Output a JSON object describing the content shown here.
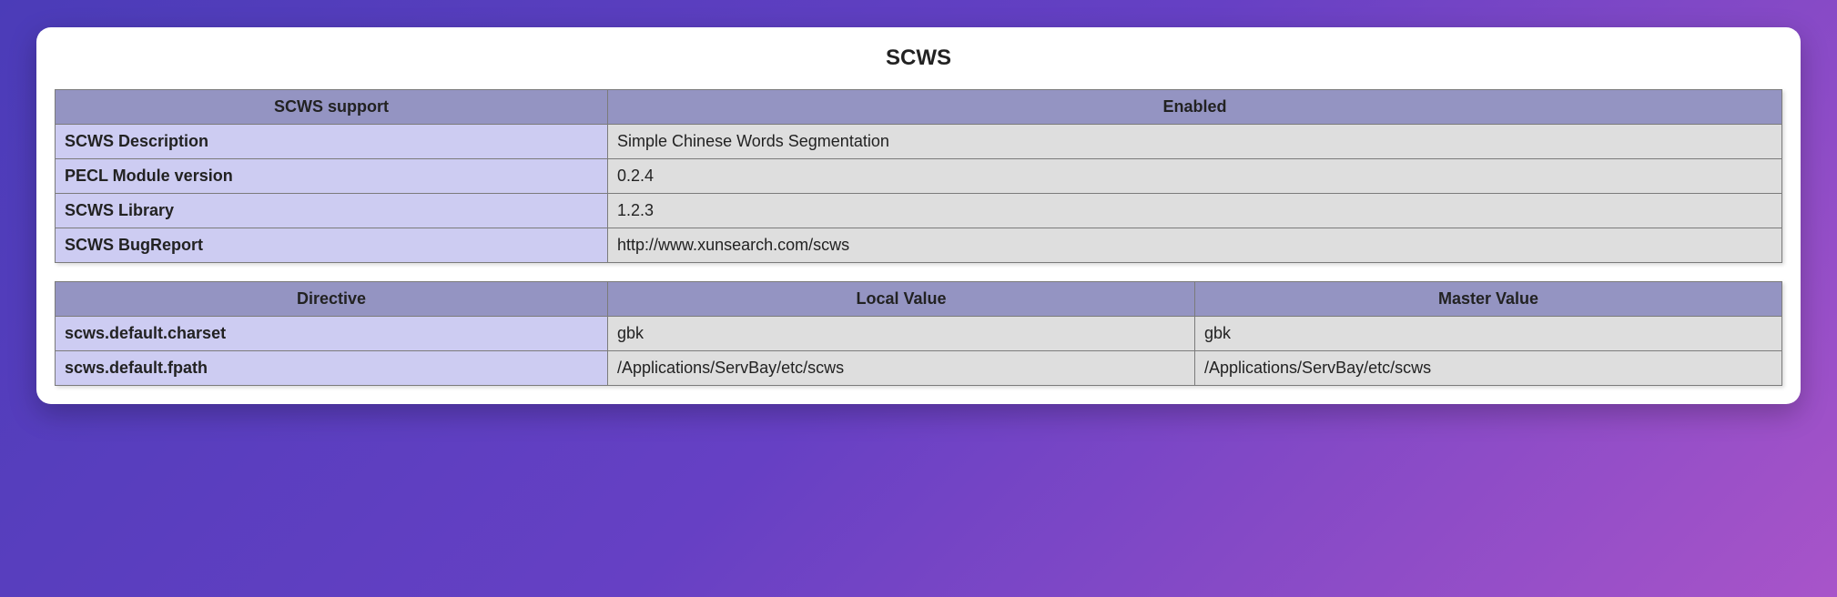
{
  "title": "SCWS",
  "info_table": {
    "headers": [
      "SCWS support",
      "Enabled"
    ],
    "rows": [
      {
        "key": "SCWS Description",
        "value": "Simple Chinese Words Segmentation"
      },
      {
        "key": "PECL Module version",
        "value": "0.2.4"
      },
      {
        "key": "SCWS Library",
        "value": "1.2.3"
      },
      {
        "key": "SCWS BugReport",
        "value": "http://www.xunsearch.com/scws"
      }
    ]
  },
  "directives_table": {
    "headers": [
      "Directive",
      "Local Value",
      "Master Value"
    ],
    "rows": [
      {
        "directive": "scws.default.charset",
        "local": "gbk",
        "master": "gbk"
      },
      {
        "directive": "scws.default.fpath",
        "local": "/Applications/ServBay/etc/scws",
        "master": "/Applications/ServBay/etc/scws"
      }
    ]
  }
}
